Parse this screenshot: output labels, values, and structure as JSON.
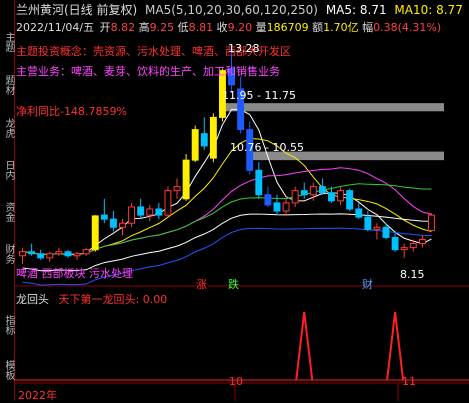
{
  "header": {
    "title": "兰州黄河(日线 前复权)",
    "ma_legend": "MA5(5,10,20,30,60,120,250)",
    "ma5": "MA5: 8.71",
    "ma10": "MA10: 8.77",
    "row2": {
      "date": "2022/11/04/五",
      "open_label": "开",
      "open": "8.82",
      "high_label": "高",
      "high": "9.25",
      "low_label": "低",
      "low": "8.81",
      "close_label": "收",
      "close": "9.20",
      "vol_label": "量",
      "vol": "186709",
      "amount_label": "额",
      "amount": "1.70亿",
      "change_label": "幅",
      "change": "0.38(4.31%)"
    }
  },
  "annotations": {
    "theme": "主题投资概念：壳资源、污水处理、啤酒、西部大开发区",
    "business": "主营业务：啤酒、麦芽、饮料的生产、加工和销售业务",
    "profit": "净利同比-148.7859%",
    "sector": "啤酒 西部板块 污水处理",
    "price_high": "13.28",
    "price_low": "8.15",
    "zone1": "11.95 - 11.75",
    "zone2": "10.76 - 10.55",
    "marker_zhang": "涨",
    "marker_die": "跌",
    "marker_cai": "财"
  },
  "indicator": {
    "name": "龙回头",
    "formula": "天下第一龙回头: 0.00"
  },
  "axis": {
    "year": "2022年",
    "month10": "10",
    "month11": "11"
  },
  "sidebar_tabs": [
    "主题",
    "题材",
    "龙虎",
    "日内",
    "资金",
    "财务",
    "指标"
  ],
  "bottom_tabs": [
    "指标",
    "模板"
  ],
  "colors": {
    "up": "#ff3b3b",
    "down": "#00bfff",
    "limit_up": "#ffee00",
    "down_big": "#1e5bff",
    "ma5": "#ffffff",
    "ma10": "#ffee00",
    "ma20": "#ff44ff",
    "ma30": "#33cc33",
    "ma60": "#ffffff",
    "ma120": "#2255ff"
  },
  "chart_data": {
    "type": "candlestick",
    "candles": [
      {
        "o": 8.2,
        "h": 8.4,
        "l": 8.0,
        "c": 8.3
      },
      {
        "o": 8.3,
        "h": 8.5,
        "l": 8.2,
        "c": 8.25
      },
      {
        "o": 8.25,
        "h": 8.35,
        "l": 8.1,
        "c": 8.15
      },
      {
        "o": 8.15,
        "h": 8.3,
        "l": 8.05,
        "c": 8.25
      },
      {
        "o": 8.25,
        "h": 8.4,
        "l": 8.2,
        "c": 8.3
      },
      {
        "o": 8.3,
        "h": 8.35,
        "l": 8.15,
        "c": 8.2
      },
      {
        "o": 8.2,
        "h": 8.3,
        "l": 8.1,
        "c": 8.25
      },
      {
        "o": 8.25,
        "h": 8.4,
        "l": 8.2,
        "c": 8.35
      },
      {
        "o": 8.35,
        "h": 9.2,
        "l": 8.3,
        "c": 9.18,
        "limit": true
      },
      {
        "o": 9.2,
        "h": 9.6,
        "l": 9.0,
        "c": 9.1
      },
      {
        "o": 9.1,
        "h": 9.3,
        "l": 8.8,
        "c": 8.9
      },
      {
        "o": 8.9,
        "h": 9.1,
        "l": 8.7,
        "c": 9.0
      },
      {
        "o": 9.0,
        "h": 9.5,
        "l": 8.9,
        "c": 9.4
      },
      {
        "o": 9.4,
        "h": 9.6,
        "l": 9.1,
        "c": 9.2
      },
      {
        "o": 9.2,
        "h": 9.45,
        "l": 9.05,
        "c": 9.35
      },
      {
        "o": 9.35,
        "h": 9.5,
        "l": 9.1,
        "c": 9.2
      },
      {
        "o": 9.2,
        "h": 9.9,
        "l": 9.15,
        "c": 9.8
      },
      {
        "o": 9.8,
        "h": 10.1,
        "l": 9.6,
        "c": 9.9
      },
      {
        "o": 9.6,
        "h": 10.7,
        "l": 9.55,
        "c": 10.55,
        "limit": true
      },
      {
        "o": 10.55,
        "h": 11.4,
        "l": 10.5,
        "c": 11.3,
        "limit": true
      },
      {
        "o": 11.2,
        "h": 11.6,
        "l": 10.8,
        "c": 10.9
      },
      {
        "o": 10.6,
        "h": 11.7,
        "l": 10.5,
        "c": 11.6,
        "limit": true
      },
      {
        "o": 11.6,
        "h": 12.8,
        "l": 11.5,
        "c": 12.75,
        "limit": true
      },
      {
        "o": 12.8,
        "h": 13.28,
        "l": 12.2,
        "c": 12.4,
        "down_big": true
      },
      {
        "o": 12.3,
        "h": 12.6,
        "l": 11.2,
        "c": 11.3,
        "down_big": true
      },
      {
        "o": 11.3,
        "h": 11.5,
        "l": 10.2,
        "c": 10.3,
        "down_big": true
      },
      {
        "o": 10.3,
        "h": 10.5,
        "l": 9.6,
        "c": 9.7
      },
      {
        "o": 9.7,
        "h": 9.9,
        "l": 9.4,
        "c": 9.45,
        "down_big": true
      },
      {
        "o": 9.5,
        "h": 9.7,
        "l": 9.2,
        "c": 9.3
      },
      {
        "o": 9.3,
        "h": 9.6,
        "l": 9.2,
        "c": 9.5
      },
      {
        "o": 9.5,
        "h": 9.9,
        "l": 9.4,
        "c": 9.8
      },
      {
        "o": 9.8,
        "h": 10.0,
        "l": 9.6,
        "c": 9.7
      },
      {
        "o": 9.7,
        "h": 10.0,
        "l": 9.55,
        "c": 9.9
      },
      {
        "o": 9.9,
        "h": 10.1,
        "l": 9.7,
        "c": 9.75
      },
      {
        "o": 9.75,
        "h": 9.9,
        "l": 9.5,
        "c": 9.55
      },
      {
        "o": 9.55,
        "h": 9.9,
        "l": 9.45,
        "c": 9.8
      },
      {
        "o": 9.8,
        "h": 9.85,
        "l": 9.3,
        "c": 9.35
      },
      {
        "o": 9.35,
        "h": 9.5,
        "l": 9.1,
        "c": 9.15
      },
      {
        "o": 9.15,
        "h": 9.3,
        "l": 8.8,
        "c": 8.85
      },
      {
        "o": 8.85,
        "h": 9.0,
        "l": 8.6,
        "c": 8.9
      },
      {
        "o": 8.9,
        "h": 9.0,
        "l": 8.6,
        "c": 8.65
      },
      {
        "o": 8.65,
        "h": 8.8,
        "l": 8.3,
        "c": 8.35
      },
      {
        "o": 8.35,
        "h": 8.5,
        "l": 8.15,
        "c": 8.4
      },
      {
        "o": 8.4,
        "h": 8.6,
        "l": 8.3,
        "c": 8.5
      },
      {
        "o": 8.5,
        "h": 8.7,
        "l": 8.4,
        "c": 8.6
      },
      {
        "o": 8.82,
        "h": 9.25,
        "l": 8.81,
        "c": 9.2
      }
    ],
    "ylim": [
      7.9,
      13.6
    ],
    "indicator_spikes": [
      27,
      37
    ]
  }
}
